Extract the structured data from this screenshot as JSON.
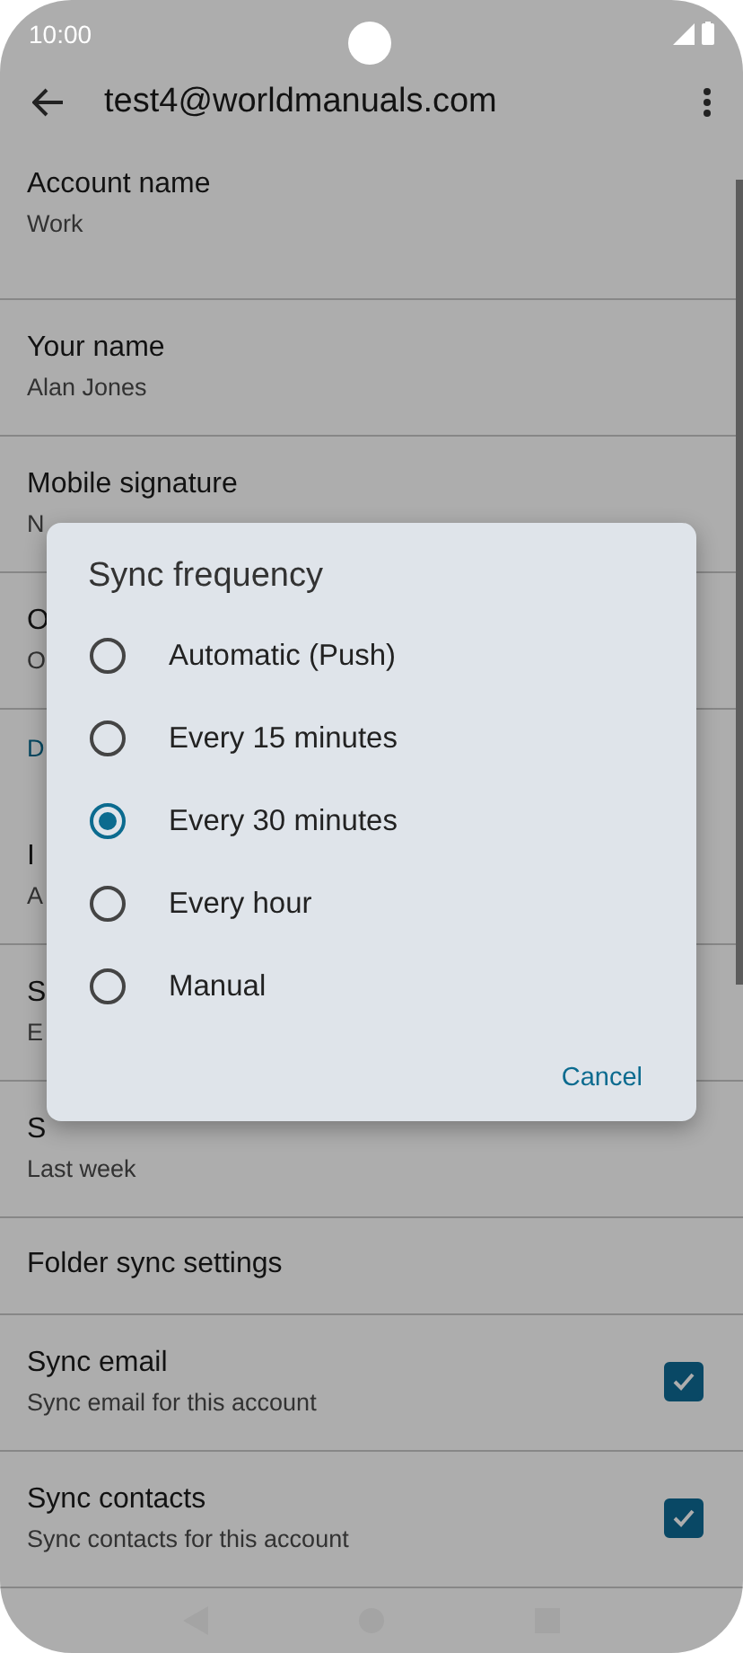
{
  "status_bar": {
    "time": "10:00"
  },
  "app_bar": {
    "title": "test4@worldmanuals.com"
  },
  "settings": [
    {
      "kind": "item",
      "title": "Account name",
      "summary": "Work"
    },
    {
      "kind": "item",
      "title": "Your name",
      "summary": "Alan Jones"
    },
    {
      "kind": "item",
      "title": "Mobile signature",
      "summary": "N"
    },
    {
      "kind": "item",
      "title": "O",
      "summary": "O"
    },
    {
      "kind": "header",
      "title": "D"
    },
    {
      "kind": "item",
      "title": "I",
      "summary": "A"
    },
    {
      "kind": "item",
      "title": "S",
      "summary": "E"
    },
    {
      "kind": "item",
      "title": "S",
      "summary": "Last week"
    },
    {
      "kind": "item",
      "title": "Folder sync settings"
    },
    {
      "kind": "checkbox",
      "title": "Sync email",
      "summary": "Sync email for this account",
      "checked": true
    },
    {
      "kind": "checkbox",
      "title": "Sync contacts",
      "summary": "Sync contacts for this account",
      "checked": true
    }
  ],
  "dialog": {
    "title": "Sync frequency",
    "options": [
      {
        "label": "Automatic (Push)",
        "selected": false
      },
      {
        "label": "Every 15 minutes",
        "selected": false
      },
      {
        "label": "Every 30 minutes",
        "selected": true
      },
      {
        "label": "Every hour",
        "selected": false
      },
      {
        "label": "Manual",
        "selected": false
      }
    ],
    "button": "Cancel"
  }
}
